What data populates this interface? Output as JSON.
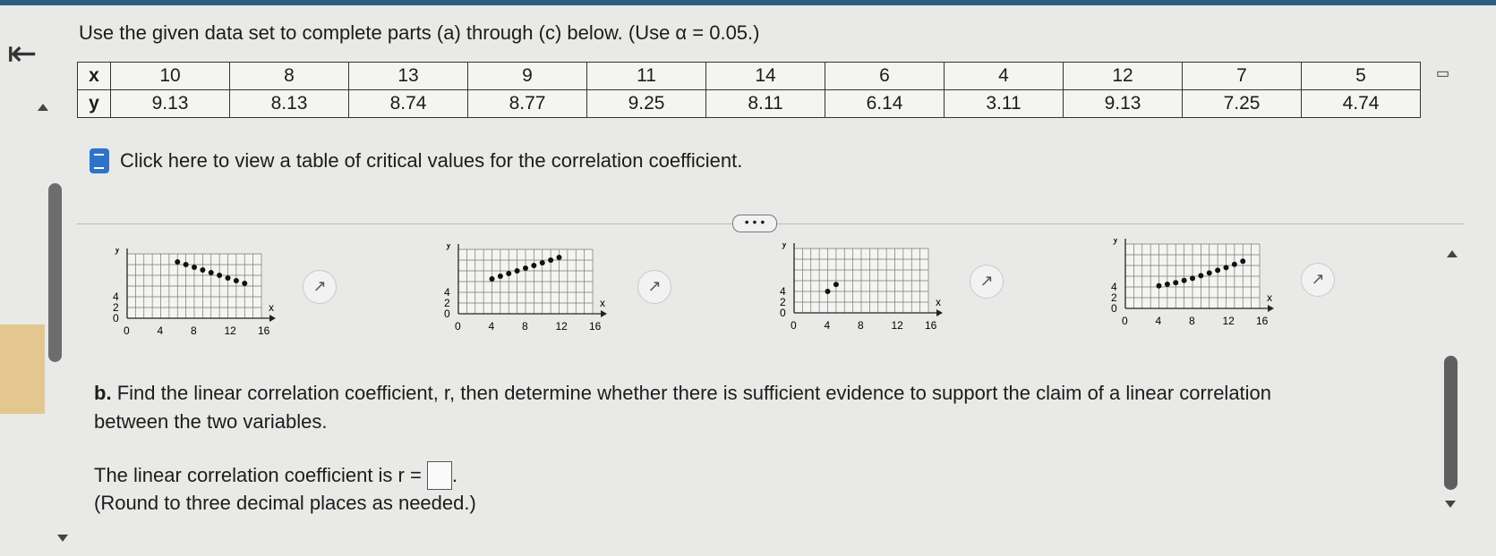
{
  "instruction": "Use the given data set to complete parts (a) through (c) below. (Use α = 0.05.)",
  "table": {
    "x_label": "x",
    "y_label": "y",
    "x": [
      "10",
      "8",
      "13",
      "9",
      "11",
      "14",
      "6",
      "4",
      "12",
      "7",
      "5"
    ],
    "y": [
      "9.13",
      "8.13",
      "8.74",
      "8.77",
      "9.25",
      "8.11",
      "6.14",
      "3.11",
      "9.13",
      "7.25",
      "4.74"
    ]
  },
  "critical_link": "Click here to view a table of critical values for the correlation coefficient.",
  "more_button": "• • •",
  "graphs": {
    "y_ticks": [
      "4",
      "2",
      "0"
    ],
    "x_ticks": [
      "0",
      "4",
      "8",
      "12",
      "16"
    ],
    "x_axis_label": "x",
    "y_axis_label": "y",
    "points": [
      [
        [
          6,
          10.5
        ],
        [
          7,
          10
        ],
        [
          8,
          9.5
        ],
        [
          9,
          9
        ],
        [
          10,
          8.5
        ],
        [
          11,
          8
        ],
        [
          12,
          7.5
        ],
        [
          13,
          7
        ],
        [
          14,
          6.5
        ]
      ],
      [
        [
          4,
          6.5
        ],
        [
          5,
          7
        ],
        [
          6,
          7.5
        ],
        [
          7,
          8
        ],
        [
          8,
          8.5
        ],
        [
          9,
          9
        ],
        [
          10,
          9.5
        ],
        [
          11,
          10
        ],
        [
          12,
          10.5
        ]
      ],
      [
        [
          4,
          4
        ],
        [
          5,
          5.3
        ]
      ],
      [
        [
          4,
          4.2
        ],
        [
          5,
          4.5
        ],
        [
          6,
          4.8
        ],
        [
          7,
          5.2
        ],
        [
          8,
          5.6
        ],
        [
          9,
          6.1
        ],
        [
          10,
          6.6
        ],
        [
          11,
          7.1
        ],
        [
          12,
          7.6
        ],
        [
          13,
          8.2
        ],
        [
          14,
          8.8
        ]
      ]
    ]
  },
  "part_b": {
    "label": "b.",
    "text": "Find the linear correlation coefficient, r, then determine whether there is sufficient evidence to support the claim of a linear correlation between the two variables.",
    "r_line": "The linear correlation coefficient is r =",
    "r_suffix": ".",
    "round_note": "(Round to three decimal places as needed.)"
  }
}
